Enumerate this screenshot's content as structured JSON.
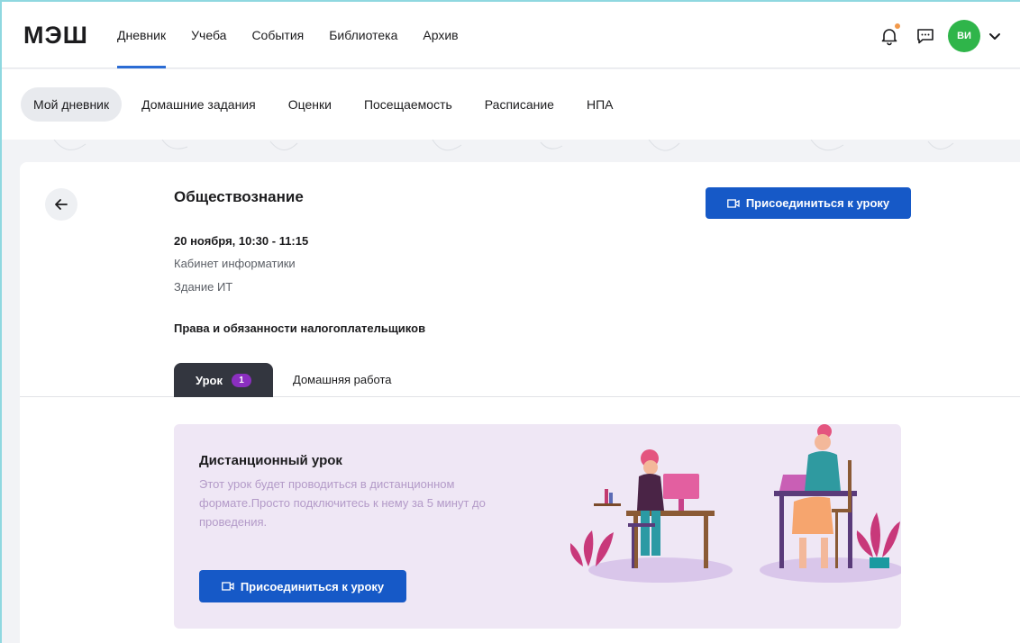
{
  "header": {
    "logo": "МЭШ",
    "nav": [
      {
        "label": "Дневник",
        "active": true
      },
      {
        "label": "Учеба",
        "active": false
      },
      {
        "label": "События",
        "active": false
      },
      {
        "label": "Библиотека",
        "active": false
      },
      {
        "label": "Архив",
        "active": false
      }
    ],
    "avatar_initials": "ВИ",
    "icons": [
      "bell-icon",
      "chat-icon",
      "chevron-down-icon"
    ]
  },
  "subnav": [
    {
      "label": "Мой дневник",
      "active": true
    },
    {
      "label": "Домашние задания",
      "active": false
    },
    {
      "label": "Оценки",
      "active": false
    },
    {
      "label": "Посещаемость",
      "active": false
    },
    {
      "label": "Расписание",
      "active": false
    },
    {
      "label": "НПА",
      "active": false
    }
  ],
  "lesson": {
    "subject": "Обществознание",
    "join_label": "Присоединиться к уроку",
    "datetime": "20 ноября, 10:30 - 11:15",
    "room": "Кабинет информатики",
    "building": "Здание ИТ",
    "topic": "Права и обязанности налогоплательщиков"
  },
  "tabs": {
    "lesson_label": "Урок",
    "lesson_badge": "1",
    "homework_label": "Домашняя работа"
  },
  "remote": {
    "title": "Дистанционный урок",
    "description": "Этот урок будет проводиться в дистанционном формате.Просто подключитесь к нему за 5 минут до проведения.",
    "join_label": "Присоединиться к уроку"
  },
  "colors": {
    "accent": "#1659c7",
    "active_underline": "#2b6cd4",
    "avatar_bg": "#2fb54a",
    "badge_bg": "#8b2fc0",
    "remote_bg": "#efe7f5",
    "notification_dot": "#f2994a"
  }
}
